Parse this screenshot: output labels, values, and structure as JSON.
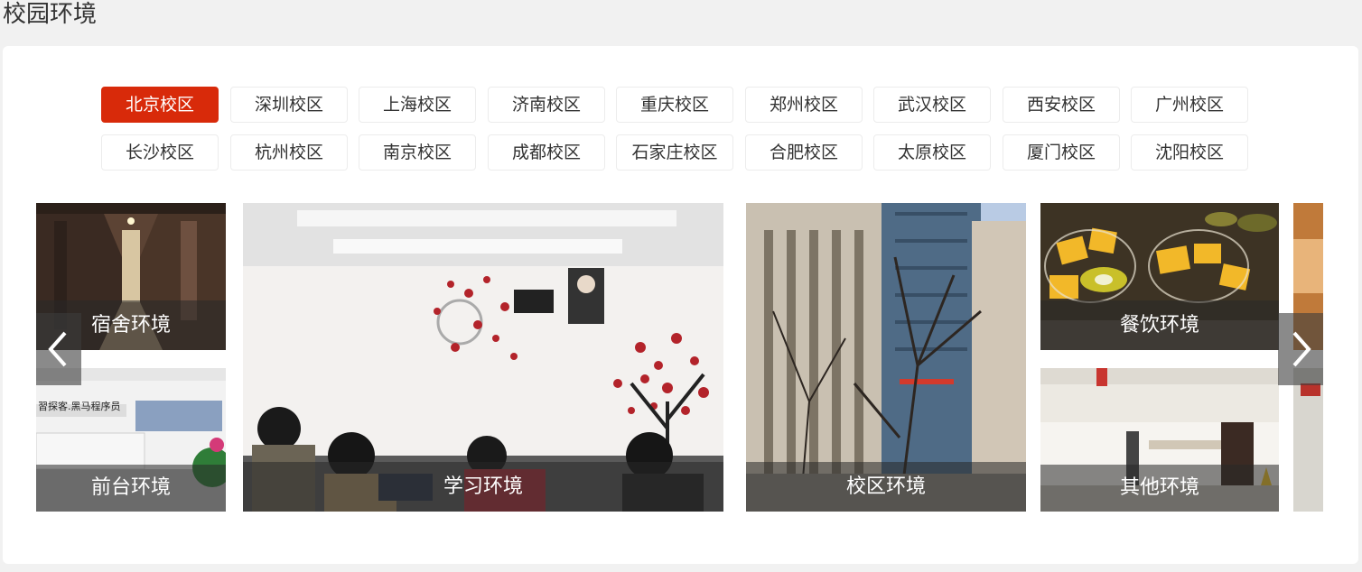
{
  "section_title": "校园环境",
  "campuses": {
    "active_index": 0,
    "items": [
      "北京校区",
      "深圳校区",
      "上海校区",
      "济南校区",
      "重庆校区",
      "郑州校区",
      "武汉校区",
      "西安校区",
      "广州校区",
      "长沙校区",
      "杭州校区",
      "南京校区",
      "成都校区",
      "石家庄校区",
      "合肥校区",
      "太原校区",
      "厦门校区",
      "沈阳校区"
    ]
  },
  "tiles": {
    "dorm": "宿舍环境",
    "front_desk": "前台环境",
    "study": "学习环境",
    "campus": "校区环境",
    "dining": "餐饮环境",
    "other": "其他环境"
  },
  "colors": {
    "accent": "#d82a0a",
    "caption_bg": "rgba(40,40,40,0.55)"
  },
  "icons": {
    "prev": "chevron-left-icon",
    "next": "chevron-right-icon"
  }
}
